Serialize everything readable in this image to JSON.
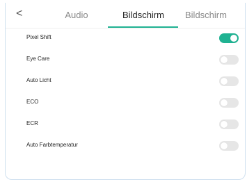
{
  "header": {
    "back_icon": "chevron-left-icon",
    "back_glyph": "<",
    "tabs": [
      {
        "label": "Audio",
        "active": false
      },
      {
        "label": "Bildschirm",
        "active": true
      },
      {
        "label": "Bildschirm",
        "active": false
      }
    ]
  },
  "settings": [
    {
      "label": "Pixel Shift",
      "enabled": true
    },
    {
      "label": "Eye Care",
      "enabled": false
    },
    {
      "label": "Auto Licht",
      "enabled": false
    },
    {
      "label": "ECO",
      "enabled": false
    },
    {
      "label": "ECR",
      "enabled": false
    },
    {
      "label": "Auto Farbtemperatur",
      "enabled": false
    }
  ],
  "colors": {
    "accent": "#1fb292",
    "toggle_off": "#e6e6e6"
  }
}
